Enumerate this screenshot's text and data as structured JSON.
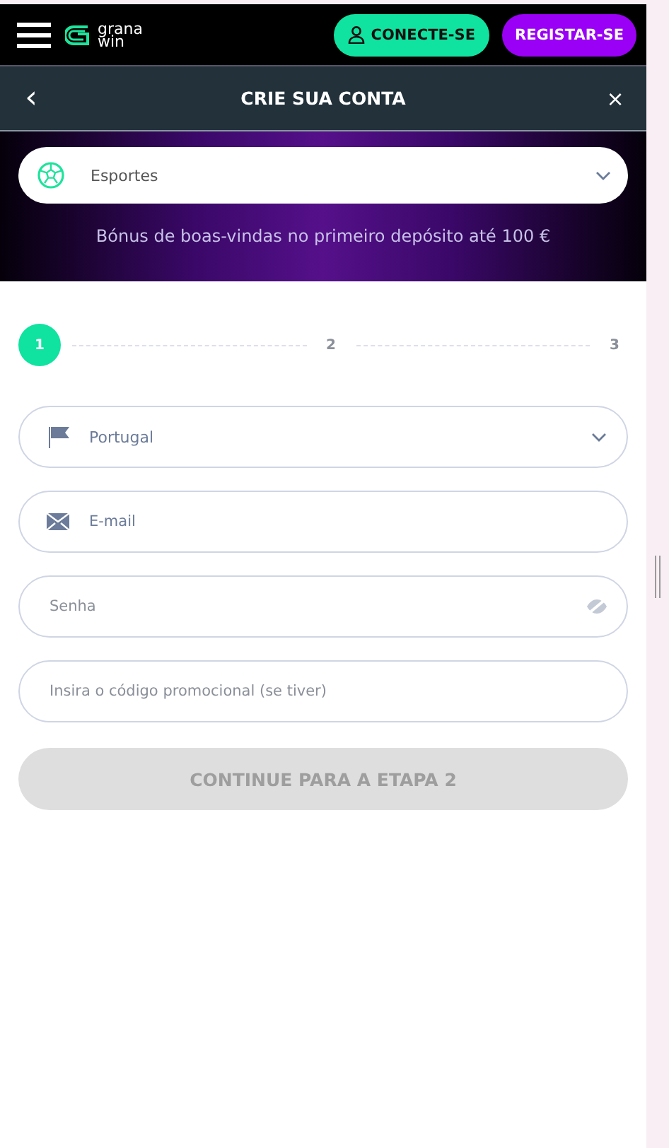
{
  "header": {
    "logo": [
      "grana",
      "win"
    ],
    "login_button": "CONECTE-SE",
    "register_button": "REGISTAR-SE"
  },
  "title_bar": {
    "back": "‹",
    "title": "CRIE SUA CONTA",
    "close": "×"
  },
  "banner": {
    "select_value": "Esportes",
    "bonus_text": "Bónus de boas-vindas no primeiro depósito até 100 €"
  },
  "steps": [
    {
      "label": "1",
      "selected": true
    },
    {
      "label": "2",
      "selected": false
    },
    {
      "label": "3",
      "selected": false
    }
  ],
  "fields": [
    {
      "kind": "country",
      "value": "Portugal"
    },
    {
      "kind": "email",
      "placeholder": "E-mail"
    },
    {
      "kind": "password",
      "placeholder": "Senha"
    },
    {
      "kind": "promo",
      "placeholder": "Insira o código promocional (se tiver)"
    }
  ],
  "submit": {
    "label": "CONTINUE PARA A ETAPA 2",
    "disabled": true
  }
}
